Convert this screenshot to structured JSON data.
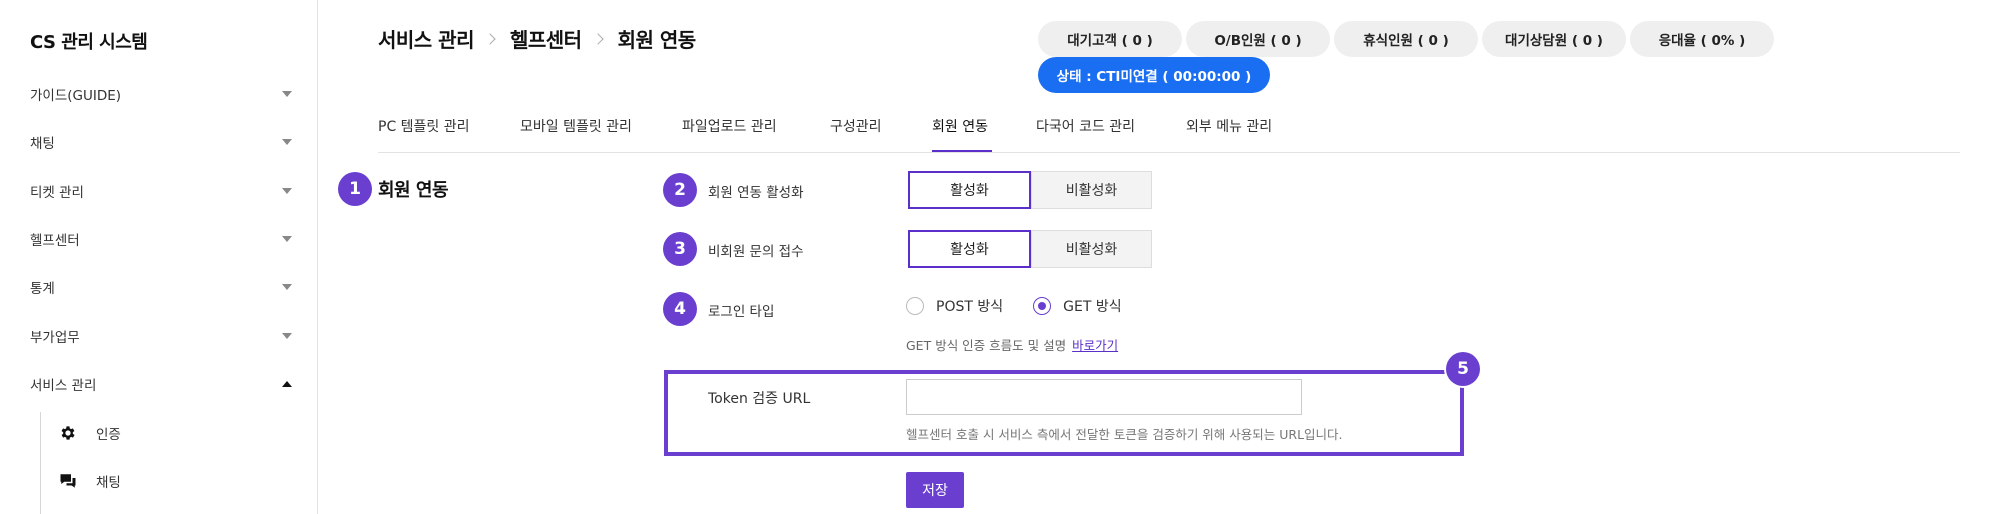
{
  "app": {
    "title": "CS 관리 시스템"
  },
  "sidebar": {
    "items": [
      {
        "label": "가이드(GUIDE)"
      },
      {
        "label": "채팅"
      },
      {
        "label": "티켓 관리"
      },
      {
        "label": "헬프센터"
      },
      {
        "label": "통계"
      },
      {
        "label": "부가업무"
      },
      {
        "label": "서비스 관리"
      }
    ],
    "sub_items": [
      {
        "label": "인증",
        "icon": "gear-icon"
      },
      {
        "label": "채팅",
        "icon": "chat-icon"
      }
    ]
  },
  "breadcrumb": [
    "서비스 관리",
    "헬프센터",
    "회원 연동"
  ],
  "status": {
    "pills": [
      "대기고객 ( 0 )",
      "O/B인원 ( 0 )",
      "휴식인원 ( 0 )",
      "대기상담원 ( 0 )",
      "응대율 ( 0% )"
    ],
    "cti": "상태 : CTI미연결 ( 00:00:00 )",
    "accent": "#1a6ef2"
  },
  "tabs": [
    "PC 템플릿 관리",
    "모바일 템플릿 관리",
    "파일업로드 관리",
    "구성관리",
    "회원 연동",
    "다국어 코드 관리",
    "외부 메뉴 관리"
  ],
  "active_tab": "회원 연동",
  "section": {
    "badge": "1",
    "title": "회원 연동"
  },
  "rows": {
    "membership": {
      "badge": "2",
      "label": "회원 연동 활성화",
      "on": "활성화",
      "off": "비활성화",
      "selected": "활성화"
    },
    "guest": {
      "badge": "3",
      "label": "비회원 문의 접수",
      "on": "활성화",
      "off": "비활성화",
      "selected": "활성화"
    },
    "login_type": {
      "badge": "4",
      "label": "로그인 타입",
      "options": [
        "POST 방식",
        "GET 방식"
      ],
      "selected": "GET 방식",
      "help": "GET 방식 인증 흐름도 및 설명",
      "help_link": "바로가기"
    },
    "token": {
      "badge": "5",
      "label": "Token 검증 URL",
      "value": "",
      "help": "헬프센터 호출 시 서비스 측에서 전달한 토큰을 검증하기 위해 사용되는 URL입니다."
    }
  },
  "save_label": "저장",
  "colors": {
    "primary": "#6a3fd0",
    "status_blue": "#1a6ef2"
  }
}
